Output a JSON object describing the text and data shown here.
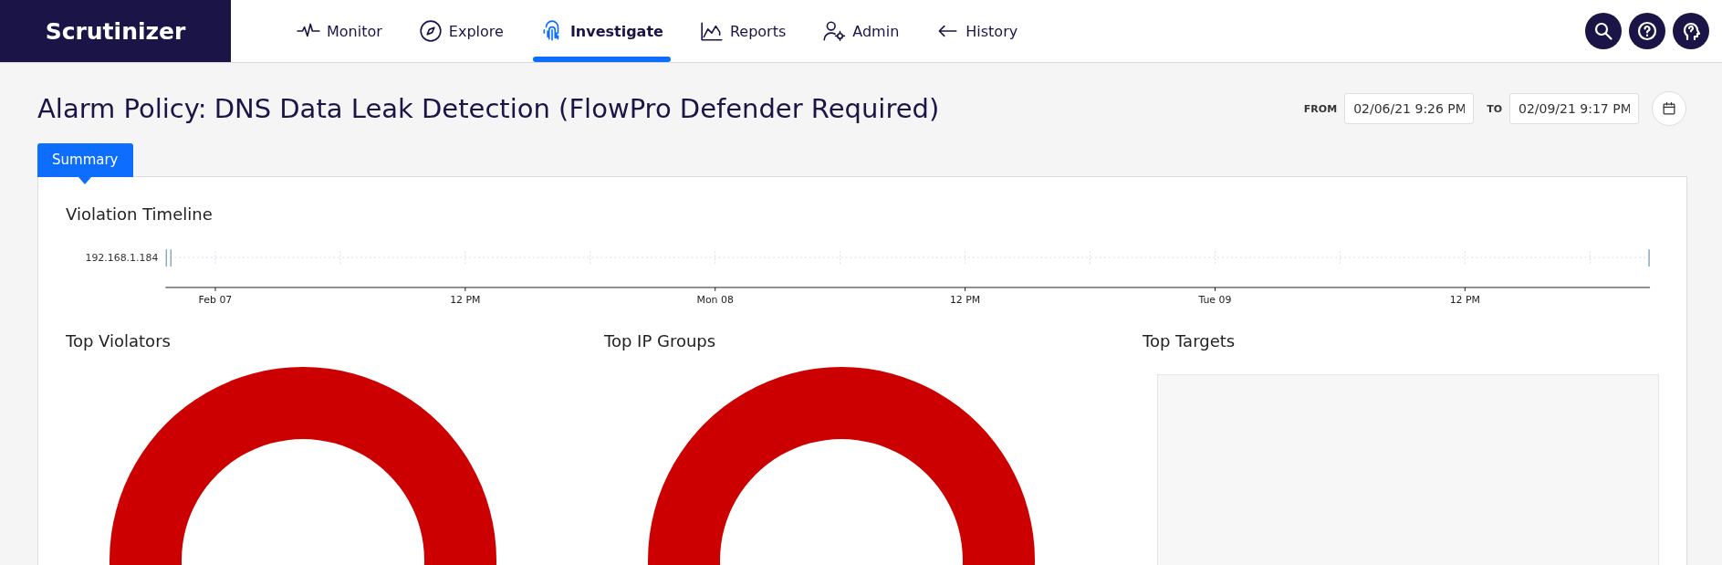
{
  "logo": "Scrutinizer",
  "nav": [
    {
      "label": "Monitor",
      "selected": false
    },
    {
      "label": "Explore",
      "selected": false
    },
    {
      "label": "Investigate",
      "selected": true
    },
    {
      "label": "Reports",
      "selected": false
    },
    {
      "label": "Admin",
      "selected": false
    },
    {
      "label": "History",
      "selected": false
    }
  ],
  "page": {
    "title_prefix": "Alarm Policy:",
    "title": "DNS Data Leak Detection (FlowPro Defender Required)",
    "from_label": "FROM",
    "from_value": "02/06/21 9:26 PM",
    "to_label": "TO",
    "to_value": "02/09/21 9:17 PM"
  },
  "tabs": [
    {
      "label": "Summary",
      "selected": true
    }
  ],
  "timeline": {
    "title": "Violation Timeline",
    "row_label": "192.168.1.184",
    "tick_labels": [
      "Feb 07",
      "12 PM",
      "Mon 08",
      "12 PM",
      "Tue 09",
      "12 PM"
    ]
  },
  "panels": [
    {
      "title": "Top Violators",
      "kind": "donut"
    },
    {
      "title": "Top IP Groups",
      "kind": "donut"
    },
    {
      "title": "Top Targets",
      "kind": "empty"
    }
  ]
}
